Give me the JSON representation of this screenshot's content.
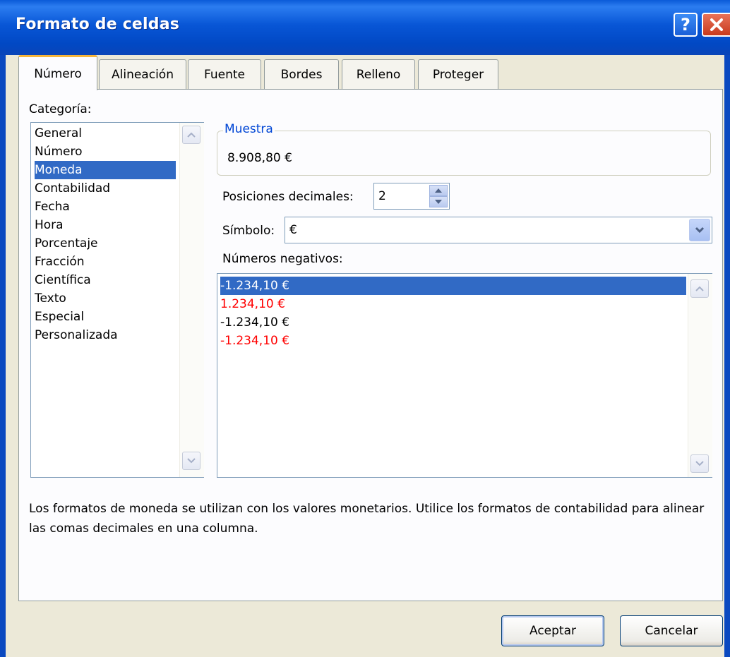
{
  "window": {
    "title": "Formato de celdas",
    "help_label": "?",
    "close_label": "✕"
  },
  "tabs": [
    {
      "label": "Número",
      "active": true
    },
    {
      "label": "Alineación",
      "active": false
    },
    {
      "label": "Fuente",
      "active": false
    },
    {
      "label": "Bordes",
      "active": false
    },
    {
      "label": "Relleno",
      "active": false
    },
    {
      "label": "Proteger",
      "active": false
    }
  ],
  "category": {
    "label": "Categoría:",
    "items": [
      "General",
      "Número",
      "Moneda",
      "Contabilidad",
      "Fecha",
      "Hora",
      "Porcentaje",
      "Fracción",
      "Científica",
      "Texto",
      "Especial",
      "Personalizada"
    ],
    "selected": "Moneda"
  },
  "sample": {
    "legend": "Muestra",
    "value": "8.908,80 €"
  },
  "decimals": {
    "label": "Posiciones decimales:",
    "value": "2"
  },
  "symbol": {
    "label": "Símbolo:",
    "value": "€"
  },
  "negatives": {
    "label": "Números negativos:",
    "items": [
      {
        "text": "-1.234,10 €",
        "color": "#000000",
        "selected": true
      },
      {
        "text": "1.234,10 €",
        "color": "#ff0000",
        "selected": false
      },
      {
        "text": "-1.234,10 €",
        "color": "#000000",
        "selected": false
      },
      {
        "text": "-1.234,10 €",
        "color": "#ff0000",
        "selected": false
      }
    ]
  },
  "description": "Los formatos de moneda se utilizan con los valores monetarios. Utilice los formatos de contabilidad para alinear las comas decimales en una columna.",
  "buttons": {
    "ok": "Aceptar",
    "cancel": "Cancelar"
  },
  "colors": {
    "titlebar": "#0856d6",
    "selection": "#316ac5",
    "group_legend": "#0046d5",
    "negative_red": "#ff0000"
  }
}
